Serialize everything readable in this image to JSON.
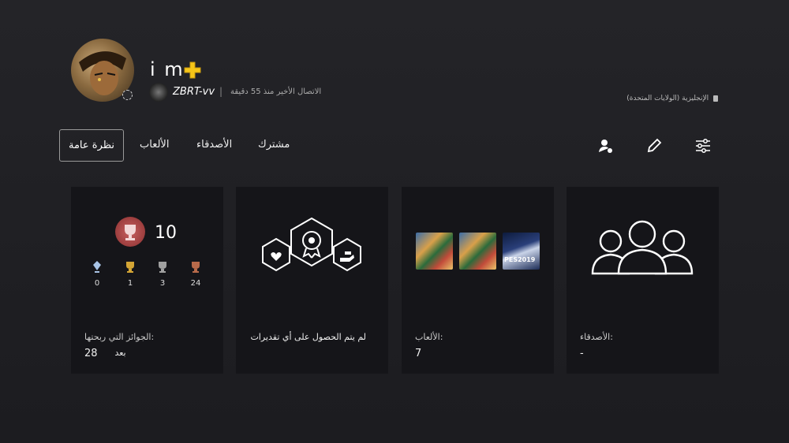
{
  "profile": {
    "name": "i m",
    "online_id": "ZBRT-vv",
    "separator": "|",
    "last_online": "الاتصال الأخير منذ 55 دقيقة",
    "language": "الإنجليزية (الولايات المتحدة)"
  },
  "tabs": {
    "overview": "نظرة عامة",
    "games": "الألعاب",
    "friends": "الأصدقاء",
    "subscription": "مشترك"
  },
  "cards": {
    "trophies": {
      "level": "10",
      "platinum": "0",
      "gold": "1",
      "silver": "3",
      "bronze": "24",
      "label": "الجوائز التي ربحتها:",
      "value": "28"
    },
    "recognition": {
      "text_line1": "لم يتم الحصول على أي تقديرات",
      "text_line2": "بعد"
    },
    "games": {
      "label": "الألعاب:",
      "value": "7",
      "thumb_labels": [
        "",
        "",
        "PES2019"
      ]
    },
    "friends": {
      "label": "الأصدقاء:",
      "value": "-"
    }
  },
  "colors": {
    "plus": "#f5c518",
    "platinum": "#a9c4e6",
    "gold": "#d4a535",
    "silver": "#a0a0a0",
    "bronze": "#b86a4a"
  }
}
